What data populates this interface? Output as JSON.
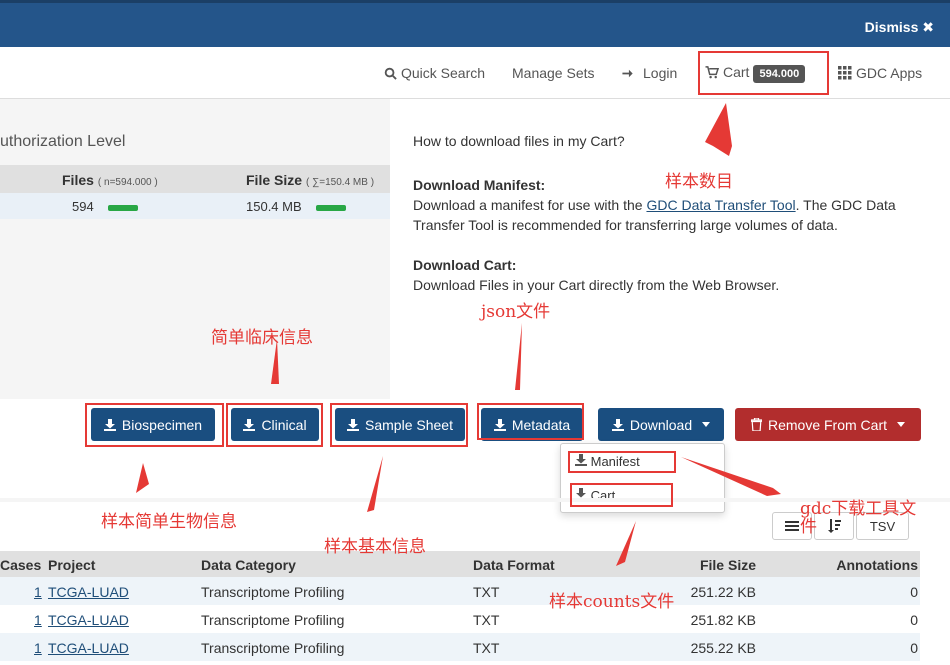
{
  "banner": {
    "dismiss_label": "Dismiss ✖"
  },
  "nav": {
    "quick_search": "Quick Search",
    "manage_sets": "Manage Sets",
    "login": "Login",
    "cart_label": "Cart",
    "cart_count": "594.000",
    "gdc_apps": "GDC Apps"
  },
  "summary": {
    "title": "uthorization Level",
    "files_header": "Files",
    "files_sub": "( n=594.000 )",
    "size_header": "File Size",
    "size_sub": "( ∑=150.4 MB )",
    "files_value": "594",
    "size_value": "150.4 MB"
  },
  "help": {
    "question": "How to download files in my Cart?",
    "manifest_title": "Download Manifest:",
    "manifest_text_1": "Download a manifest for use with the ",
    "manifest_link": "GDC Data Transfer Tool",
    "manifest_text_2": ". The GDC Data",
    "manifest_text_3": "Transfer Tool is recommended for transferring large volumes of data.",
    "cart_title": "Download Cart:",
    "cart_text": "Download Files in your Cart directly from the Web Browser."
  },
  "buttons": {
    "biospecimen": "Biospecimen",
    "clinical": "Clinical",
    "sample_sheet": "Sample Sheet",
    "metadata": "Metadata",
    "download": "Download",
    "remove": "Remove From Cart"
  },
  "dropdown": {
    "manifest": "Manifest",
    "cart": "Cart"
  },
  "tools": {
    "tsv": "TSV"
  },
  "annotations": {
    "sample_count": "样本数目",
    "clinical_info": "简单临床信息",
    "json_file": "json文件",
    "biospecimen_info": "样本简单生物信息",
    "sample_info": "样本基本信息",
    "gdc_tool_1": "gdc下载工具文",
    "gdc_tool_2": "件",
    "counts_file": "样本counts文件"
  },
  "table": {
    "headers": {
      "cases": "Cases",
      "project": "Project",
      "category": "Data Category",
      "format": "Data Format",
      "size": "File Size",
      "annotations": "Annotations"
    },
    "rows": [
      {
        "cases": "1",
        "project": "TCGA-LUAD",
        "category": "Transcriptome Profiling",
        "format": "TXT",
        "size": "251.22 KB",
        "annotations": "0"
      },
      {
        "cases": "1",
        "project": "TCGA-LUAD",
        "category": "Transcriptome Profiling",
        "format": "TXT",
        "size": "251.82 KB",
        "annotations": "0"
      },
      {
        "cases": "1",
        "project": "TCGA-LUAD",
        "category": "Transcriptome Profiling",
        "format": "TXT",
        "size": "255.22 KB",
        "annotations": "0"
      }
    ]
  },
  "colors": {
    "banner": "#24558a",
    "primary_button": "#1a4e80",
    "danger_button": "#b22d2d",
    "annotation": "#e53935"
  }
}
